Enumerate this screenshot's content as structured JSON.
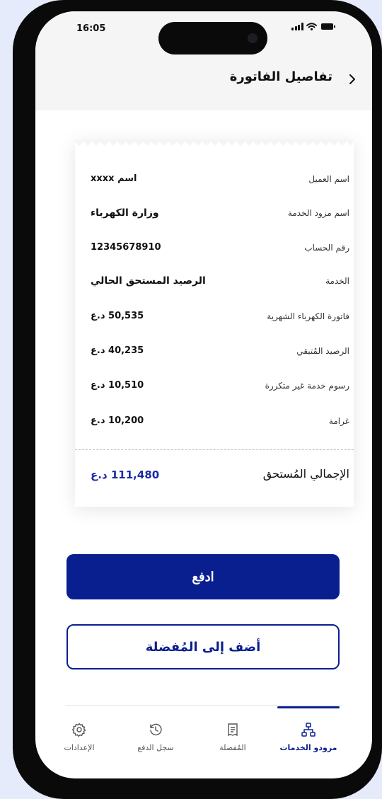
{
  "status_bar": {
    "time": "16:05"
  },
  "header": {
    "title": "تفاصيل الفاتورة"
  },
  "bill": {
    "rows": [
      {
        "label": "اسم العميل",
        "value": "اسم xxxx"
      },
      {
        "label": "اسم مزود الخدمة",
        "value": "وزارة الكهرباء"
      },
      {
        "label": "رقم الحساب",
        "value": "12345678910"
      },
      {
        "label": "الخدمة",
        "value": "الرصيد المستحق الحالي"
      },
      {
        "label": "فاتورة الكهرباء الشهرية",
        "value": "50,535 د.ع"
      },
      {
        "label": "الرصيد المُتبقي",
        "value": "40,235 د.ع"
      },
      {
        "label": "رسوم خدمة غير متكررة",
        "value": "10,510 د.ع"
      },
      {
        "label": "غرامة",
        "value": "10,200 د.ع"
      }
    ],
    "total_label": "الإجمالي المُستحق",
    "total_value": "111,480 د.ع"
  },
  "actions": {
    "pay_label": "ادفع",
    "favorite_label": "أضف إلى المُفضلة"
  },
  "nav": {
    "items": [
      {
        "label": "مزودو الخدمات",
        "icon": "sitemap-icon",
        "active": true
      },
      {
        "label": "المُفضلة",
        "icon": "receipt-icon",
        "active": false
      },
      {
        "label": "سجل الدفع",
        "icon": "history-icon",
        "active": false
      },
      {
        "label": "الإعدادات",
        "icon": "gear-icon",
        "active": false
      }
    ]
  },
  "colors": {
    "primary": "#0a1f8f",
    "total_text": "#1b2aa3",
    "background": "#e5ebfb"
  }
}
